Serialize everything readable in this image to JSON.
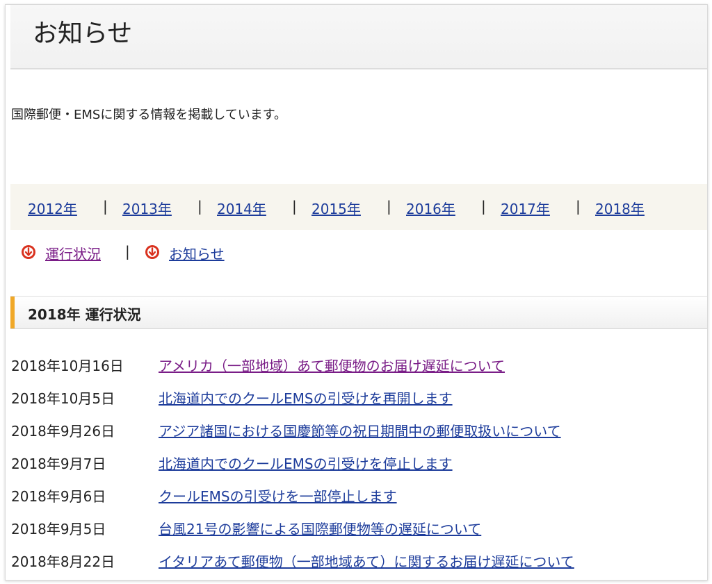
{
  "page": {
    "title": "お知らせ",
    "intro": "国際郵便・EMSに関する情報を掲載しています。"
  },
  "year_nav": {
    "items": [
      "2012年",
      "2013年",
      "2014年",
      "2015年",
      "2016年",
      "2017年",
      "2018年"
    ],
    "separator": "|"
  },
  "anchors": {
    "items": [
      {
        "label": "運行状況",
        "icon": "circle-down-arrow-icon"
      },
      {
        "label": "お知らせ",
        "icon": "circle-down-arrow-icon"
      }
    ],
    "separator": "|"
  },
  "section": {
    "heading": "2018年 運行状況",
    "accent_color": "#f0a828"
  },
  "news": [
    {
      "date": "2018年10月16日",
      "title": "アメリカ（一部地域）あて郵便物のお届け遅延について",
      "visited": true
    },
    {
      "date": "2018年10月5日",
      "title": "北海道内でのクールEMSの引受けを再開します",
      "visited": false
    },
    {
      "date": "2018年9月26日",
      "title": "アジア諸国における国慶節等の祝日期間中の郵便取扱いについて",
      "visited": false
    },
    {
      "date": "2018年9月7日",
      "title": "北海道内でのクールEMSの引受けを停止します",
      "visited": false
    },
    {
      "date": "2018年9月6日",
      "title": "クールEMSの引受けを一部停止します",
      "visited": false
    },
    {
      "date": "2018年9月5日",
      "title": "台風21号の影響による国際郵便物等の遅延について",
      "visited": false
    },
    {
      "date": "2018年8月22日",
      "title": "イタリアあて郵便物（一部地域あて）に関するお届け遅延について",
      "visited": false
    }
  ],
  "colors": {
    "link": "#1d3c9b",
    "visited_link": "#7a1d87",
    "icon_red": "#d9321f"
  }
}
